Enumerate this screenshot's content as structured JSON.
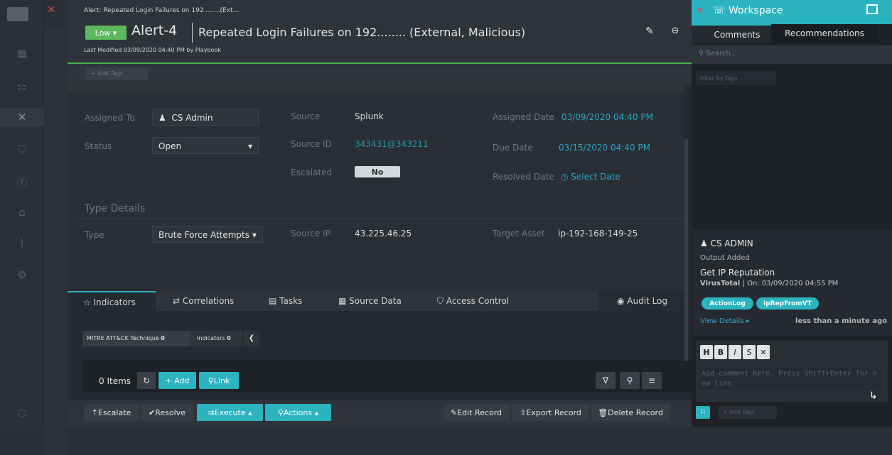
{
  "header": {
    "breadcrumb": "Alert: Repeated Login Failures on 192........(Ext...",
    "severity": "Low",
    "id": "Alert-4",
    "title": "Repeated Login Failures on 192........ (External, Malicious)",
    "modified": "Last Modified 03/09/2020 04:40 PM by Playbook",
    "add_tags": "+ Add Tags"
  },
  "fields": {
    "assigned_to_label": "Assigned To",
    "assigned_to": "CS Admin",
    "status_label": "Status",
    "status": "Open",
    "source_label": "Source",
    "source": "Splunk",
    "source_id_label": "Source ID",
    "source_id": "343431@343211",
    "escalated_label": "Escalated",
    "escalated": "No",
    "assigned_date_label": "Assigned Date",
    "assigned_date": "03/09/2020 04:40 PM",
    "due_date_label": "Due Date",
    "due_date": "03/15/2020 04:40 PM",
    "resolved_date_label": "Resolved Date",
    "resolved_date": "Select Date"
  },
  "type_details": {
    "heading": "Type Details",
    "type_label": "Type",
    "type": "Brute Force Attempts",
    "source_ip_label": "Source IP",
    "source_ip": "43.225.46.25",
    "target_asset_label": "Target Asset",
    "target_asset": "ip-192-168-149-25"
  },
  "tabs": [
    "Indicators",
    "Correlations",
    "Tasks",
    "Source Data",
    "Access Control",
    "Audit Log"
  ],
  "subtabs": {
    "mitre": "MITRE ATT&CK Technique",
    "mitre_count": "0",
    "indicators": "Indicators",
    "indicators_count": "0"
  },
  "list": {
    "items": "0 Items",
    "add": "+ Add",
    "link": "Link"
  },
  "footer": {
    "escalate": "Escalate",
    "resolve": "Resolve",
    "execute": "Execute",
    "actions": "Actions",
    "edit": "Edit Record",
    "export": "Export Record",
    "delete": "Delete Record"
  },
  "workspace": {
    "title": "Workspace",
    "tab_comments": "Comments",
    "tab_recommendations": "Recommendations",
    "search_placeholder": "Search...",
    "filter_placeholder": "Filter By Tags ..",
    "comment_user": "CS ADMIN",
    "comment_type": "Output Added",
    "comment_title": "Get IP Reputation",
    "comment_source": "VirusTotal",
    "comment_meta": "| On: 03/09/2020 04:55 PM",
    "tag1": "ActionLog",
    "tag2": "ipRepFromVT",
    "view_details": "View Details",
    "time_ago": "less than a minute ago",
    "editor_placeholder": "Add comment here. Press Shift+Enter for new line.",
    "add_tags": "+ Add Tags"
  }
}
